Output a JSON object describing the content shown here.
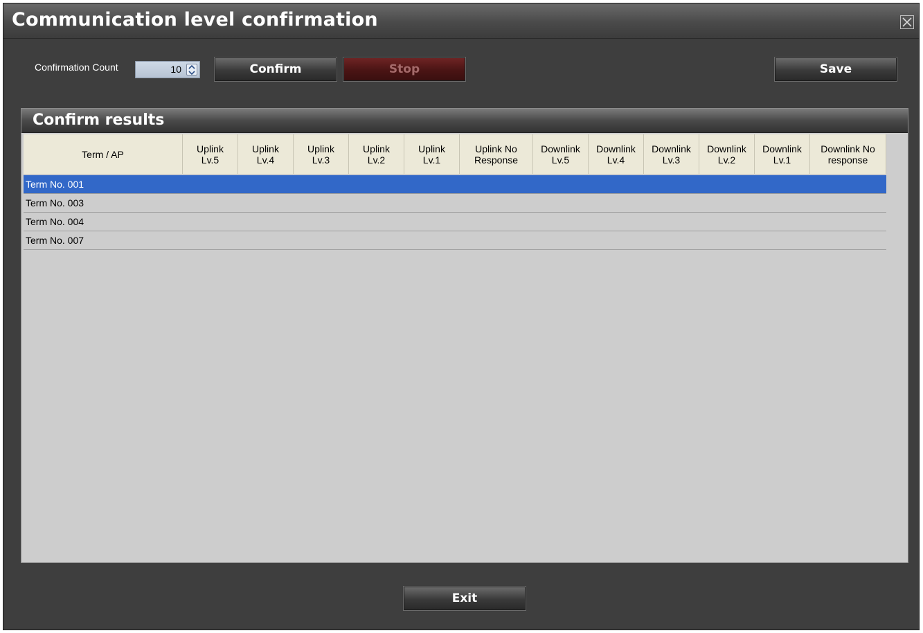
{
  "window": {
    "title": "Communication level confirmation",
    "close_icon": "close-icon"
  },
  "toolbar": {
    "count_label": "Confirmation Count",
    "count_value": "10",
    "confirm_label": "Confirm",
    "stop_label": "Stop",
    "save_label": "Save"
  },
  "results": {
    "title": "Confirm results",
    "columns": [
      "Term / AP",
      "Uplink\nLv.5",
      "Uplink\nLv.4",
      "Uplink\nLv.3",
      "Uplink\nLv.2",
      "Uplink\nLv.1",
      "Uplink No\nResponse",
      "Downlink\nLv.5",
      "Downlink\nLv.4",
      "Downlink\nLv.3",
      "Downlink\nLv.2",
      "Downlink\nLv.1",
      "Downlink No\nresponse"
    ],
    "rows": [
      {
        "term": "Term No. 001",
        "selected": true
      },
      {
        "term": "Term No. 003",
        "selected": false
      },
      {
        "term": "Term No. 004",
        "selected": false
      },
      {
        "term": "Term No. 007",
        "selected": false
      }
    ]
  },
  "footer": {
    "exit_label": "Exit"
  }
}
